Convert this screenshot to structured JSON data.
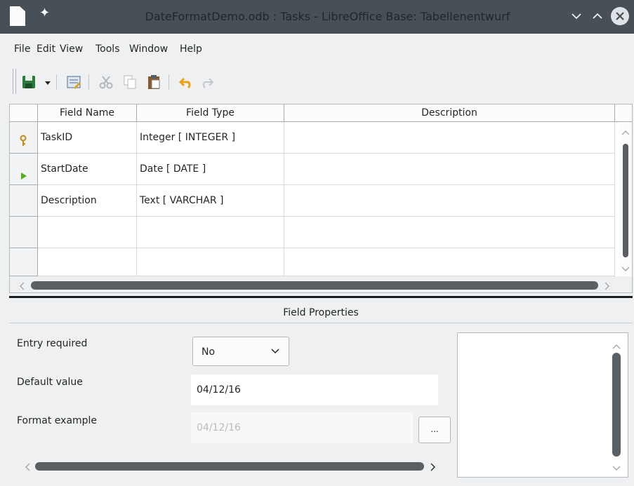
{
  "window": {
    "title": "DateFormatDemo.odb : Tasks - LibreOffice Base: Tabellenentwurf"
  },
  "menubar": {
    "items": [
      {
        "label": "File"
      },
      {
        "label": "Edit"
      },
      {
        "label": "View"
      },
      {
        "label": "Tools"
      },
      {
        "label": "Window"
      },
      {
        "label": "Help"
      }
    ]
  },
  "toolbar": {
    "icons": [
      "save-icon",
      "dropdown-arrow-icon",
      "design-mode-icon",
      "cut-icon",
      "copy-icon",
      "paste-icon",
      "undo-icon",
      "redo-icon"
    ]
  },
  "table": {
    "headers": {
      "field_name": "Field Name",
      "field_type": "Field Type",
      "description": "Description"
    },
    "rows": [
      {
        "field_name": "TaskID",
        "field_type": "Integer [ INTEGER ]",
        "description": "",
        "marker": "primary-key-icon"
      },
      {
        "field_name": "StartDate",
        "field_type": "Date [ DATE ]",
        "description": "",
        "marker": "current-row-icon"
      },
      {
        "field_name": "Description",
        "field_type": "Text [ VARCHAR ]",
        "description": "",
        "marker": ""
      },
      {
        "field_name": "",
        "field_type": "",
        "description": "",
        "marker": ""
      },
      {
        "field_name": "",
        "field_type": "",
        "description": "",
        "marker": ""
      }
    ]
  },
  "properties": {
    "title": "Field Properties",
    "entry_required": {
      "label": "Entry required",
      "value": "No"
    },
    "default_value": {
      "label": "Default value",
      "value": "04/12/16"
    },
    "format_example": {
      "label": "Format example",
      "value": "04/12/16",
      "button_label": "..."
    }
  },
  "colors": {
    "titlebar": "#475057",
    "window_bg": "#eff0f1",
    "scroll_thumb": "#5a5f63",
    "key_icon": "#d4a017",
    "current_row_icon": "#4caf1c"
  }
}
